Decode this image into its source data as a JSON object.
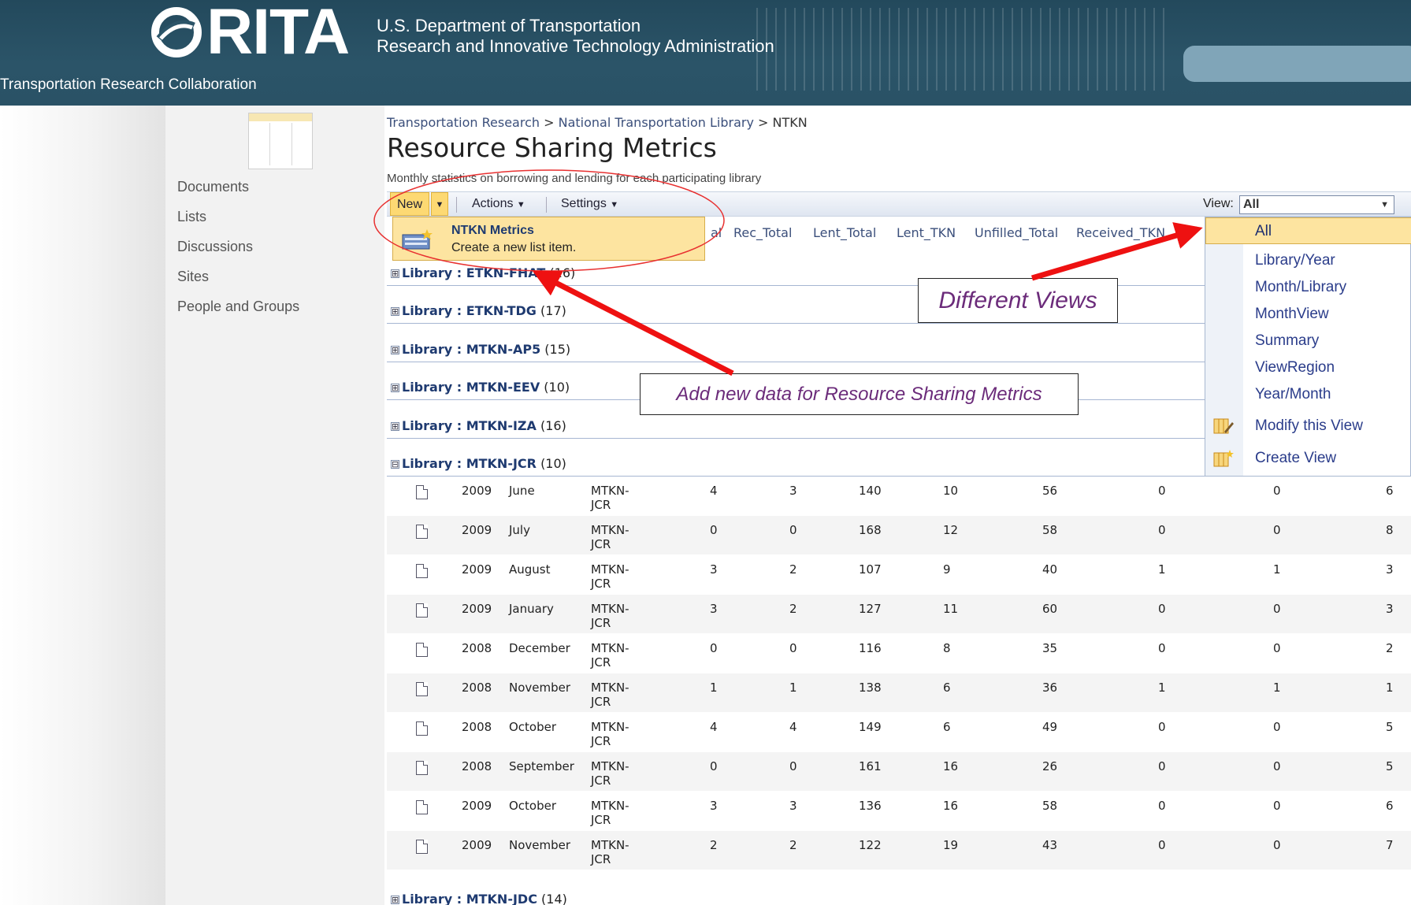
{
  "header": {
    "logo_text": "RITA",
    "dept_line1": "U.S. Department of Transportation",
    "dept_line2": "Research and Innovative Technology Administration",
    "site_title": "Transportation Research Collaboration"
  },
  "nav": [
    "Documents",
    "Lists",
    "Discussions",
    "Sites",
    "People and Groups"
  ],
  "breadcrumb": {
    "a": "Transportation Research",
    "sep": ">",
    "b": "National Transportation Library",
    "c": "NTKN"
  },
  "page": {
    "title": "Resource Sharing Metrics",
    "description": "Monthly statistics on borrowing and lending for each participating library"
  },
  "toolbar": {
    "new": "New",
    "actions": "Actions",
    "settings": "Settings",
    "view_label": "View:",
    "view_value": "All",
    "dropdown_glyph": "▼"
  },
  "new_menu": {
    "title": "NTKN Metrics",
    "desc": "Create a new list item."
  },
  "columns": [
    "Rec_Total",
    "Lent_Total",
    "Lent_TKN",
    "Unfilled_Total",
    "Received_TKN"
  ],
  "col_fragment": "al",
  "groups": [
    {
      "label": "Library",
      "sep": " : ",
      "name": "ETKN-FHAT",
      "count": "(16)",
      "toggle": "⊞"
    },
    {
      "label": "Library",
      "sep": " : ",
      "name": "ETKN-TDG",
      "count": "(17)",
      "toggle": "⊞"
    },
    {
      "label": "Library",
      "sep": " : ",
      "name": "MTKN-AP5",
      "count": "(15)",
      "toggle": "⊞"
    },
    {
      "label": "Library",
      "sep": " : ",
      "name": "MTKN-EEV",
      "count": "(10)",
      "toggle": "⊞"
    },
    {
      "label": "Library",
      "sep": " : ",
      "name": "MTKN-IZA",
      "count": "(16)",
      "toggle": "⊞"
    },
    {
      "label": "Library",
      "sep": " : ",
      "name": "MTKN-JCR",
      "count": "(10)",
      "toggle": "⊟"
    },
    {
      "label": "Library",
      "sep": " : ",
      "name": "MTKN-JDC",
      "count": "(14)",
      "toggle": "⊞"
    }
  ],
  "rows": [
    {
      "year": "2009",
      "month": "June",
      "lib1": "MTKN-",
      "lib2": "JCR",
      "c1": "4",
      "c2": "3",
      "c3": "140",
      "c4": "10",
      "c5": "56",
      "c6": "0",
      "c7": "0",
      "c8": "6"
    },
    {
      "year": "2009",
      "month": "July",
      "lib1": "MTKN-",
      "lib2": "JCR",
      "c1": "0",
      "c2": "0",
      "c3": "168",
      "c4": "12",
      "c5": "58",
      "c6": "0",
      "c7": "0",
      "c8": "8"
    },
    {
      "year": "2009",
      "month": "August",
      "lib1": "MTKN-",
      "lib2": "JCR",
      "c1": "3",
      "c2": "2",
      "c3": "107",
      "c4": "9",
      "c5": "40",
      "c6": "1",
      "c7": "1",
      "c8": "3"
    },
    {
      "year": "2009",
      "month": "January",
      "lib1": "MTKN-",
      "lib2": "JCR",
      "c1": "3",
      "c2": "2",
      "c3": "127",
      "c4": "11",
      "c5": "60",
      "c6": "0",
      "c7": "0",
      "c8": "3"
    },
    {
      "year": "2008",
      "month": "December",
      "lib1": "MTKN-",
      "lib2": "JCR",
      "c1": "0",
      "c2": "0",
      "c3": "116",
      "c4": "8",
      "c5": "35",
      "c6": "0",
      "c7": "0",
      "c8": "2"
    },
    {
      "year": "2008",
      "month": "November",
      "lib1": "MTKN-",
      "lib2": "JCR",
      "c1": "1",
      "c2": "1",
      "c3": "138",
      "c4": "6",
      "c5": "36",
      "c6": "1",
      "c7": "1",
      "c8": "1"
    },
    {
      "year": "2008",
      "month": "October",
      "lib1": "MTKN-",
      "lib2": "JCR",
      "c1": "4",
      "c2": "4",
      "c3": "149",
      "c4": "6",
      "c5": "49",
      "c6": "0",
      "c7": "0",
      "c8": "5"
    },
    {
      "year": "2008",
      "month": "September",
      "lib1": "MTKN-",
      "lib2": "JCR",
      "c1": "0",
      "c2": "0",
      "c3": "161",
      "c4": "16",
      "c5": "26",
      "c6": "0",
      "c7": "0",
      "c8": "5"
    },
    {
      "year": "2009",
      "month": "October",
      "lib1": "MTKN-",
      "lib2": "JCR",
      "c1": "3",
      "c2": "3",
      "c3": "136",
      "c4": "16",
      "c5": "58",
      "c6": "0",
      "c7": "0",
      "c8": "6"
    },
    {
      "year": "2009",
      "month": "November",
      "lib1": "MTKN-",
      "lib2": "JCR",
      "c1": "2",
      "c2": "2",
      "c3": "122",
      "c4": "19",
      "c5": "43",
      "c6": "0",
      "c7": "0",
      "c8": "7"
    }
  ],
  "view_menu": [
    "All",
    "Library/Year",
    "Month/Library",
    "MonthView",
    "Summary",
    "ViewRegion",
    "Year/Month",
    "Modify this View",
    "Create View"
  ],
  "annotations": {
    "views": "Different Views",
    "add": "Add new data for Resource Sharing Metrics"
  },
  "colors": {
    "header": "#2b5468",
    "highlight": "#fde4a0",
    "link": "#2a3c8a",
    "arrow": "#ee1111"
  }
}
